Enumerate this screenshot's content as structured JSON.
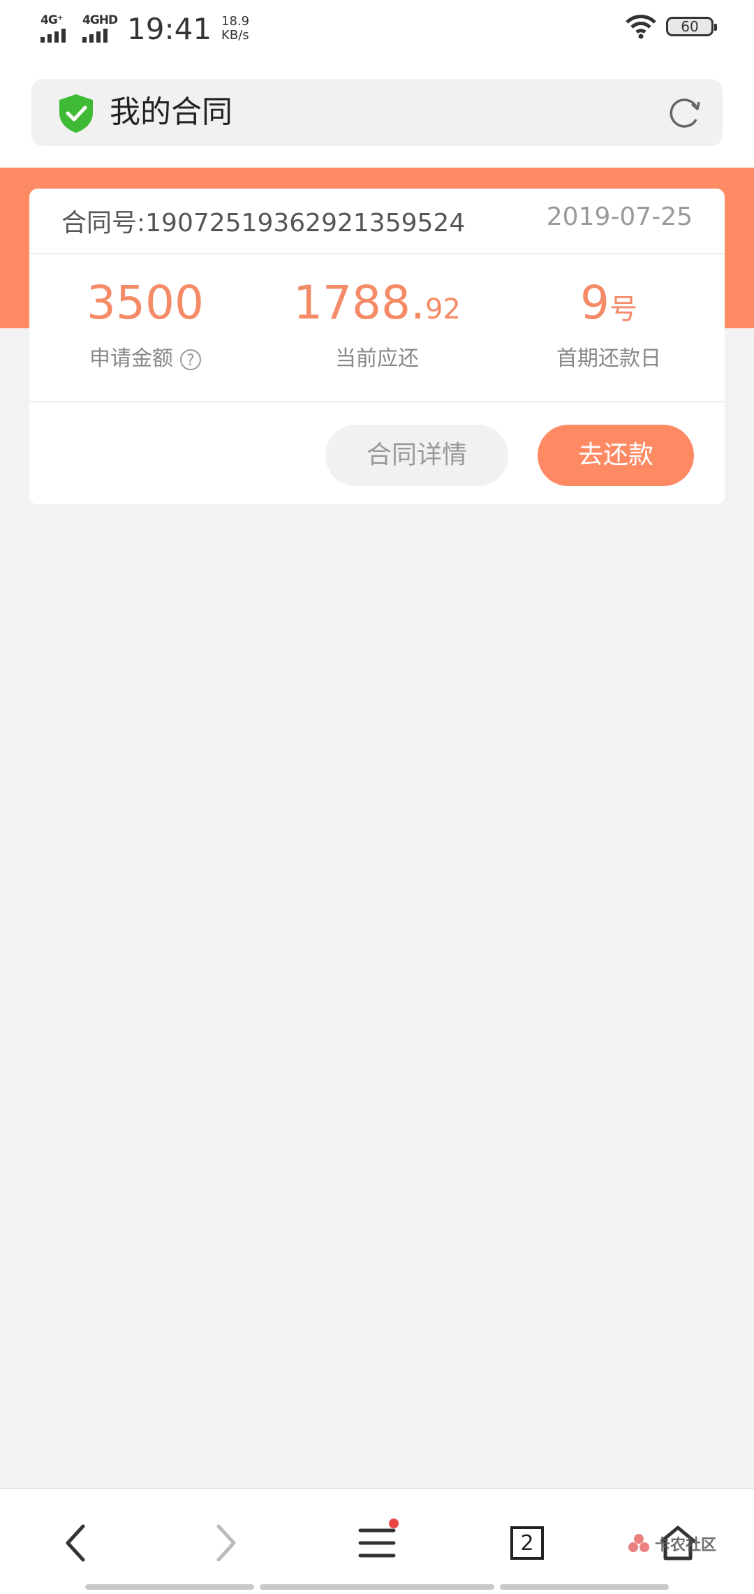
{
  "status_bar": {
    "network_1": "4G⁺",
    "network_2": "4GHD",
    "time": "19:41",
    "speed_value": "18.9",
    "speed_unit": "KB/s",
    "battery": "60"
  },
  "header": {
    "title": "我的合同"
  },
  "contract": {
    "number_label": "合同号:",
    "number": "19072519362921359524",
    "date": "2019-07-25",
    "applied_amount": "3500",
    "applied_amount_label": "申请金额",
    "help_icon_glyph": "?",
    "current_due_int": "1788.",
    "current_due_dec": "92",
    "current_due_label": "当前应还",
    "repay_day": "9",
    "repay_day_unit": "号",
    "repay_day_label": "首期还款日",
    "detail_button": "合同详情",
    "pay_button": "去还款"
  },
  "bottom_nav": {
    "tab_count": "2",
    "watermark_text": "卡农社区"
  },
  "colors": {
    "accent": "#fe8a64",
    "value_text": "#f58a66",
    "shield": "#3fba35"
  }
}
